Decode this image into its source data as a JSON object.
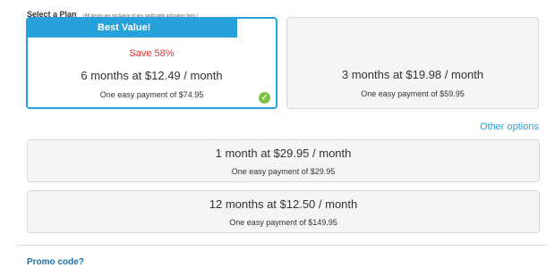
{
  "header": {
    "title": "Select a Plan",
    "note": "(All prices are exclusive of any applicable activation fees.)"
  },
  "plans": [
    {
      "ribbon": "Best Value!",
      "discount": "Save 58%",
      "main": "6 months at $12.49 / month",
      "sub": "One easy payment of $74.95",
      "selected": true
    },
    {
      "main": "3 months at $19.98 / month",
      "sub": "One easy payment of $59.95",
      "selected": false
    }
  ],
  "other_options_link": "Other options",
  "other_plans": [
    {
      "main": "1 month at $29.95 / month",
      "sub": "One easy payment of $29.95"
    },
    {
      "main": "12 months at $12.50 / month",
      "sub": "One easy payment of $149.95"
    }
  ],
  "promo_label": "Promo code?",
  "colors": {
    "accent": "#27a1d9",
    "discount": "#e8312a",
    "check": "#7dc244"
  }
}
